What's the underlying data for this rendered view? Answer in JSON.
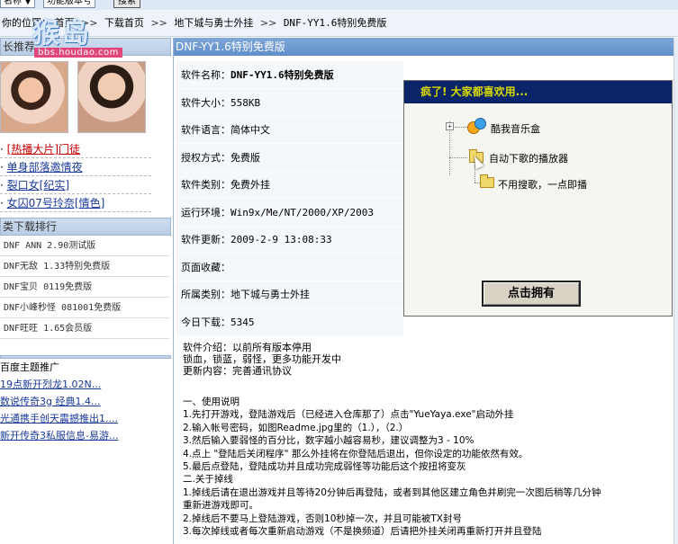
{
  "topbar": {
    "select_label": "名称 ▼",
    "select2_label": "功能版本号",
    "search_button": "搜索"
  },
  "breadcrumb": {
    "prefix": "你的位置：",
    "items": [
      "首页",
      "下载首页",
      "地下城与勇士外挂",
      "DNF-YY1.6特别免费版"
    ],
    "separator": ">>"
  },
  "watermark": {
    "logo_text": "猴岛",
    "url": "bbs.houdao.com"
  },
  "sidebar": {
    "recommend_title": "长推荐",
    "hot_links": [
      {
        "text": "[热播大片]门徒",
        "red": true
      },
      {
        "text": "单身部落邀情夜",
        "red": false
      },
      {
        "text": "裂口女[纪实]",
        "red": false
      },
      {
        "text": "女囚07号玲奈[情色]",
        "red": false
      }
    ],
    "rank_title": "类下载排行",
    "rank_items": [
      "DNF ANN 2.90测试版",
      "DNF无敌 1.33特别免费版",
      "DNF宝贝 0119免费版",
      "DNF小峰秒怪 081001免费版",
      "DNF旺旺 1.65会员版"
    ],
    "topic_title": "百度主题推广",
    "topic_links": [
      "19点新开烈龙1.02N...",
      "数说传奇3g 经典1.4...",
      "光通携手创天震撼推出1....",
      "新开传奇3私服信息-易游..."
    ]
  },
  "main": {
    "header": "DNF-YY1.6特别免费版",
    "info": [
      {
        "key": "软件名称：",
        "value": "DNF-YY1.6特别免费版",
        "bold": true
      },
      {
        "key": "软件大小：",
        "value": "558KB",
        "bold": false
      },
      {
        "key": "软件语言：",
        "value": "简体中文",
        "bold": false
      },
      {
        "key": "授权方式：",
        "value": "免费版",
        "bold": false
      },
      {
        "key": "软件类别：",
        "value": "免费外挂",
        "bold": false
      },
      {
        "key": "运行环境：",
        "value": "Win9x/Me/NT/2000/XP/2003",
        "bold": false
      },
      {
        "key": "软件更新：",
        "value": "2009-2-9 13:08:33",
        "bold": false
      },
      {
        "key": "页面收藏：",
        "value": "",
        "bold": false
      },
      {
        "key": "所属类别：",
        "value": "地下城与勇士外挂",
        "bold": false
      },
      {
        "key": "今日下载：",
        "value": "5345",
        "bold": false
      }
    ],
    "intro_lines": [
      "软件介绍：以前所有版本停用",
      "锁血，锁蓝，弱怪，更多功能开发中",
      "更新内容：完善通讯协议"
    ],
    "instructions": [
      "一、使用说明",
      "1.先打开游戏，登陆游戏后（已经进入仓库那了）点击\"YueYaya.exe\"启动外挂",
      "2.输入帐号密码，如图Readme.jpg里的（1.），（2.）",
      "3.然后输入要弱怪的百分比，数字越小越容易秒，建议调整为3 - 10%",
      "4.点上 \"登陆后关闭程序\" 那么外挂将在你登陆后退出，但你设定的功能依然有效。",
      "5.最后点登陆，登陆成功并且成功完成弱怪等功能后这个按扭将变灰",
      "二.关于掉线",
      "1.掉线后请在退出游戏并且等待20分钟后再登陆，或者到其他区建立角色并刷完一次图后稍等几分钟",
      "重新进游戏即可。",
      "2.掉线后不要马上登陆游戏，否则10秒掉一次，并且可能被TX封号",
      "3.每次掉线或者每次重新启动游戏（不是换频道）后请把外挂关闭再重新打开并且登陆"
    ]
  },
  "popup": {
    "title": "疯了! 大家都喜欢用...",
    "tree_items": [
      "酷我音乐盒",
      "自动下歌的播放器",
      "不用搜歌，一点即播"
    ],
    "button": "点击拥有"
  }
}
